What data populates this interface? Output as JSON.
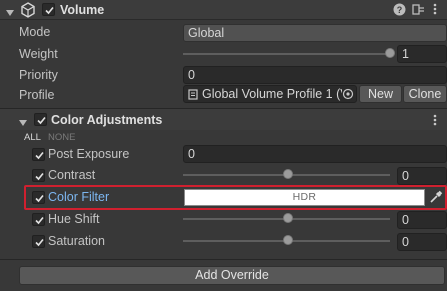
{
  "component": {
    "title": "Volume"
  },
  "volume": {
    "mode_label": "Mode",
    "mode_value": "Global",
    "weight_label": "Weight",
    "weight_value": "1",
    "weight_level": 1.0,
    "priority_label": "Priority",
    "priority_value": "0",
    "profile_label": "Profile",
    "profile_value": "Global Volume Profile 1 (V",
    "new_button": "New",
    "clone_button": "Clone"
  },
  "override": {
    "title": "Color Adjustments",
    "all_label": "ALL",
    "none_label": "NONE",
    "rows": [
      {
        "label": "Post Exposure",
        "value": "0",
        "kind": "field"
      },
      {
        "label": "Contrast",
        "value": "0",
        "kind": "slider",
        "level": 0.5
      },
      {
        "label": "Color Filter",
        "value": "HDR",
        "kind": "color",
        "highlighted": true
      },
      {
        "label": "Hue Shift",
        "value": "0",
        "kind": "slider",
        "level": 0.5
      },
      {
        "label": "Saturation",
        "value": "0",
        "kind": "slider",
        "level": 0.5
      }
    ]
  },
  "add_override_label": "Add Override",
  "colors": {
    "background": "#383838",
    "highlight_border": "#d0202f",
    "link_blue": "#7cb6f0"
  }
}
